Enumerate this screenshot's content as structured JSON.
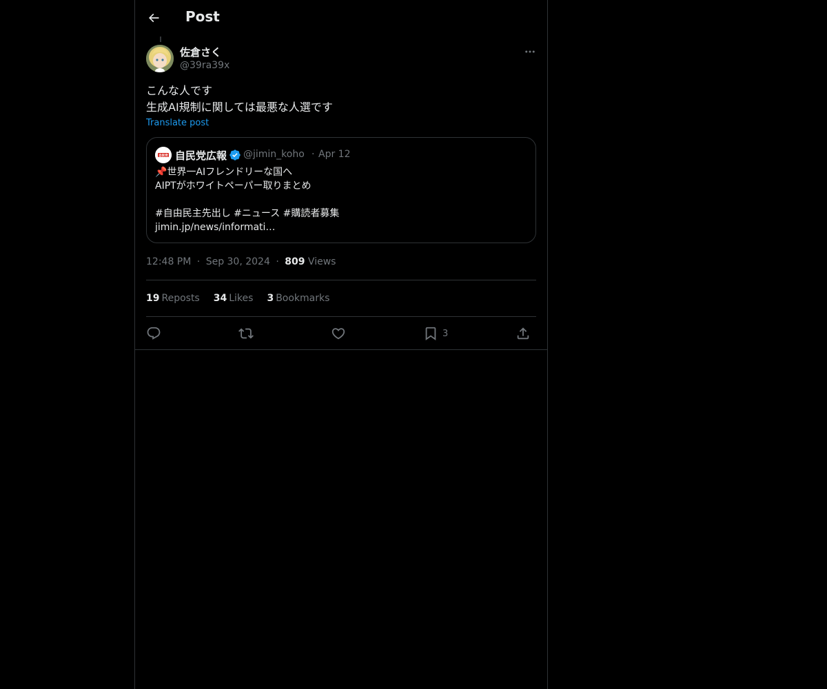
{
  "header": {
    "title": "Post"
  },
  "post": {
    "author_name": "佐倉さく",
    "author_handle": "@39ra39x",
    "text_lines": [
      "こんな人です",
      "生成AI規制に関しては最悪な人選です"
    ],
    "translate_label": "Translate post",
    "time": "12:48 PM",
    "date": "Sep 30, 2024",
    "views_count": "809",
    "views_label": "Views",
    "separator": "·"
  },
  "quote": {
    "name": "自民党広報",
    "handle": "@jimin_koho",
    "date": "Apr 12",
    "separator": "·",
    "avatar_text": "自民党",
    "text_lines": [
      "📌世界一AIフレンドリーな国へ",
      "AIPTがホワイトペーパー取りまとめ",
      "",
      "#自由民主先出し #ニュース #購読者募集",
      "jimin.jp/news/informati…"
    ]
  },
  "stats": {
    "reposts_count": "19",
    "reposts_label": "Reposts",
    "likes_count": "34",
    "likes_label": "Likes",
    "bookmarks_count": "3",
    "bookmarks_label": "Bookmarks"
  },
  "actions": {
    "bookmark_count": "3"
  },
  "colors": {
    "accent": "#1d9bf0",
    "border": "#2f3336",
    "muted": "#71767b",
    "text": "#e7e9ea"
  }
}
